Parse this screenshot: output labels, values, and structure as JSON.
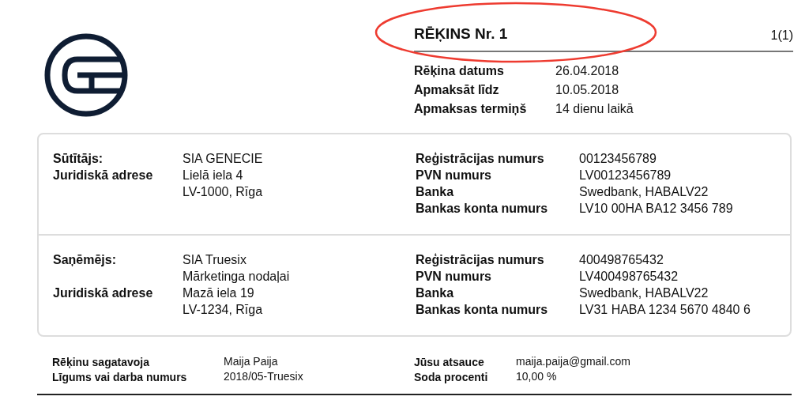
{
  "header": {
    "title": "RĒĶINS Nr. 1",
    "page": "1(1)",
    "rows": [
      {
        "label": "Rēķina datums",
        "value": "26.04.2018"
      },
      {
        "label": "Apmaksāt līdz",
        "value": "10.05.2018"
      },
      {
        "label": "Apmaksas termiņš",
        "value": "14 dienu laikā"
      }
    ]
  },
  "parties": [
    {
      "left": [
        {
          "label": "Sūtītājs:",
          "value": "SIA GENECIE"
        },
        {
          "label": "Juridiskā adrese",
          "value": "Lielā iela 4"
        },
        {
          "value": "LV-1000, Rīga"
        }
      ],
      "right": [
        {
          "label": "Reģistrācijas numurs",
          "value": "00123456789"
        },
        {
          "label": "PVN numurs",
          "value": "LV00123456789"
        },
        {
          "label": "Banka",
          "value": "Swedbank, HABALV22"
        },
        {
          "label": "Bankas konta numurs",
          "value": "LV10 00HA BA12 3456 789"
        }
      ]
    },
    {
      "left": [
        {
          "label": "Saņēmējs:",
          "value": "SIA Truesix"
        },
        {
          "value": "Mārketinga nodaļai"
        },
        {
          "label": "Juridiskā adrese",
          "value": "Mazā iela 19"
        },
        {
          "value": "LV-1234, Rīga"
        }
      ],
      "right": [
        {
          "label": "Reģistrācijas numurs",
          "value": "400498765432"
        },
        {
          "label": "PVN numurs",
          "value": "LV400498765432"
        },
        {
          "label": "Banka",
          "value": "Swedbank, HABALV22"
        },
        {
          "label": "Bankas konta numurs",
          "value": "LV31 HABA 1234 5670 4840 6"
        }
      ]
    }
  ],
  "footer": {
    "left": [
      {
        "label": "Rēķinu sagatavoja",
        "value": "Maija Paija"
      },
      {
        "label": "Līgums vai darba numurs",
        "value": "2018/05-Truesix"
      }
    ],
    "right": [
      {
        "label": "Jūsu atsauce",
        "value": "maija.paija@gmail.com"
      },
      {
        "label": "Soda procenti",
        "value": "10,00 %"
      }
    ]
  }
}
